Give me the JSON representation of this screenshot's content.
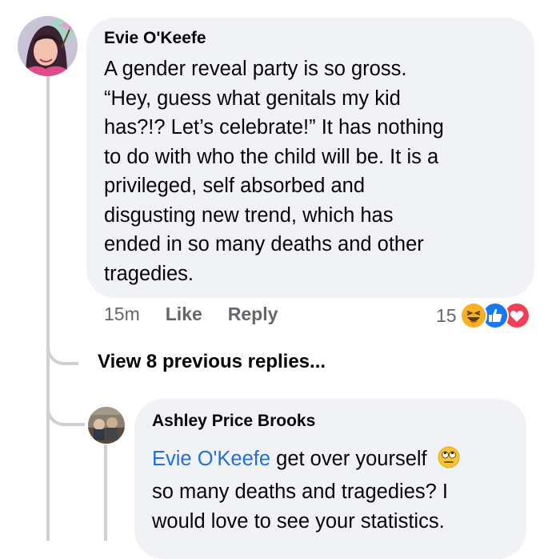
{
  "comment": {
    "author": "Evie O'Keefe",
    "text_lines": [
      "A gender reveal party is so gross.",
      "“Hey, guess what genitals my kid",
      "has?!?  Let’s celebrate!”  It has nothing",
      "to do with who the child will be.  It is a",
      "privileged, self absorbed and",
      "disgusting new trend, which has",
      "ended in so many deaths and other",
      "tragedies."
    ],
    "time": "15m",
    "like_label": "Like",
    "reply_label": "Reply",
    "reaction_count": "15"
  },
  "thread": {
    "view_more_label": "View 8 previous replies..."
  },
  "reply": {
    "author": "Ashley Price Brooks",
    "mention": "Evie O'Keefe",
    "text_first_rest": " get over yourself",
    "text_lines": [
      "so many deaths and tragedies? I",
      "would love to see your statistics."
    ]
  },
  "colors": {
    "bubble": "#f0f2f5",
    "thread_line": "#ced0d4",
    "mention": "#216fdb",
    "haha": "#f7b125",
    "like": "#1877f2",
    "love": "#f33e58"
  },
  "icons": [
    "avatar-evie",
    "avatar-ashley",
    "haha-icon",
    "like-icon",
    "love-icon",
    "eye-roll-emoji-icon"
  ]
}
